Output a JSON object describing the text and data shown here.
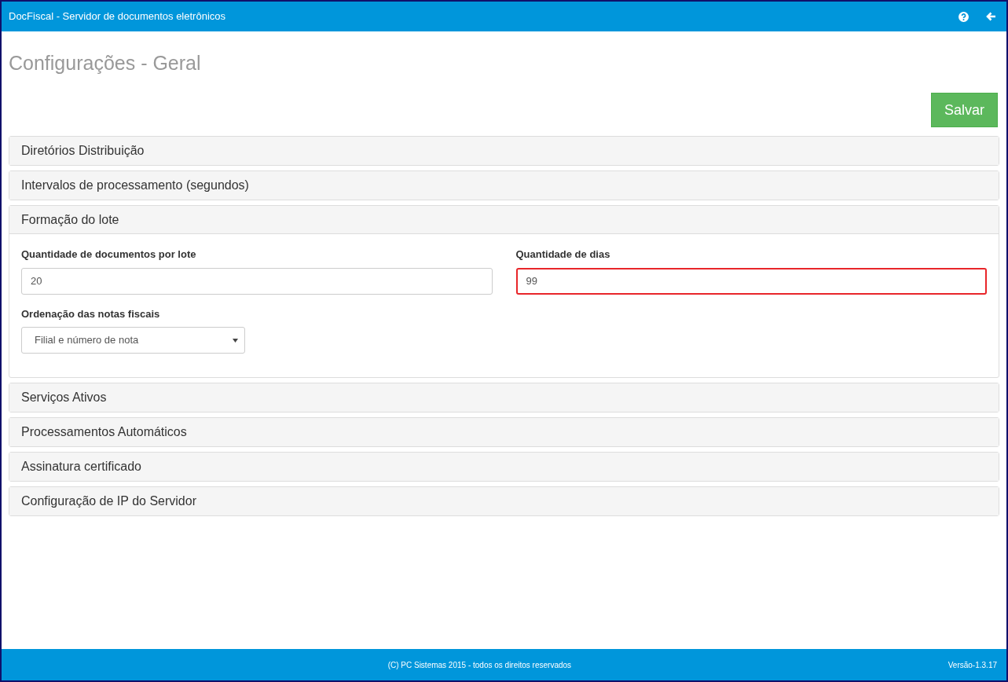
{
  "app_bar": {
    "title": "DocFiscal - Servidor de documentos eletrônicos"
  },
  "page_title": "Configurações - Geral",
  "save_button": "Salvar",
  "panels": [
    {
      "title": "Diretórios Distribuição",
      "expanded": false
    },
    {
      "title": "Intervalos de processamento (segundos)",
      "expanded": false
    },
    {
      "title": "Formação do lote",
      "expanded": true,
      "fields": [
        {
          "kind": "input",
          "label": "Quantidade de documentos por lote",
          "value": "20",
          "highlighted": false
        },
        {
          "kind": "input",
          "label": "Quantidade de dias",
          "value": "99",
          "highlighted": true
        },
        {
          "kind": "select",
          "label": "Ordenação das notas fiscais",
          "value": "Filial e número de nota",
          "highlighted": false
        }
      ]
    },
    {
      "title": "Serviços Ativos",
      "expanded": false
    },
    {
      "title": "Processamentos Automáticos",
      "expanded": false
    },
    {
      "title": "Assinatura certificado",
      "expanded": false
    },
    {
      "title": "Configuração de IP do Servidor",
      "expanded": false
    }
  ],
  "footer": {
    "copyright": "(C) PC Sistemas 2015 - todos os direitos reservados",
    "version": "Versão-1.3.17"
  }
}
